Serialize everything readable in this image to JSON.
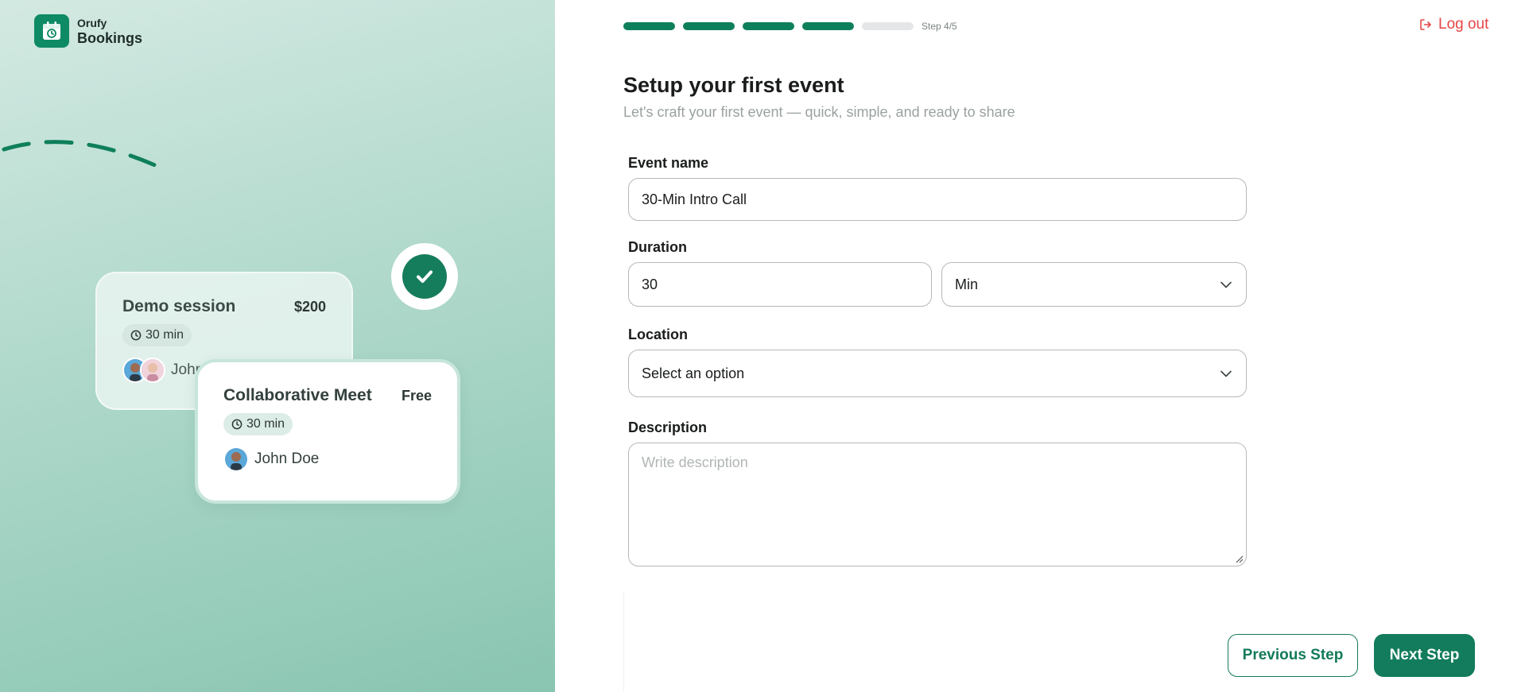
{
  "brand": {
    "name_top": "Orufy",
    "name_bottom": "Bookings"
  },
  "illustration": {
    "card_back": {
      "title": "Demo session",
      "price": "$200",
      "duration": "30 min",
      "person": "John"
    },
    "card_front": {
      "title": "Collaborative Meet",
      "price": "Free",
      "duration": "30 min",
      "person": "John Doe"
    }
  },
  "progress": {
    "total_steps": 5,
    "completed_steps": 4,
    "label": "Step 4/5"
  },
  "header": {
    "logout_label": "Log out"
  },
  "page": {
    "title": "Setup your first event",
    "subtitle": "Let's craft your first event — quick, simple, and ready to share"
  },
  "form": {
    "event_name": {
      "label": "Event name",
      "value": "30-Min Intro Call"
    },
    "duration": {
      "label": "Duration",
      "value": "30",
      "unit": "Min"
    },
    "location": {
      "label": "Location",
      "value": "Select an option"
    },
    "description": {
      "label": "Description",
      "placeholder": "Write description"
    }
  },
  "actions": {
    "previous_label": "Previous Step",
    "next_label": "Next Step"
  },
  "colors": {
    "accent": "#127c5c",
    "danger": "#e64545",
    "panel_bg": "#a9d5c6"
  }
}
